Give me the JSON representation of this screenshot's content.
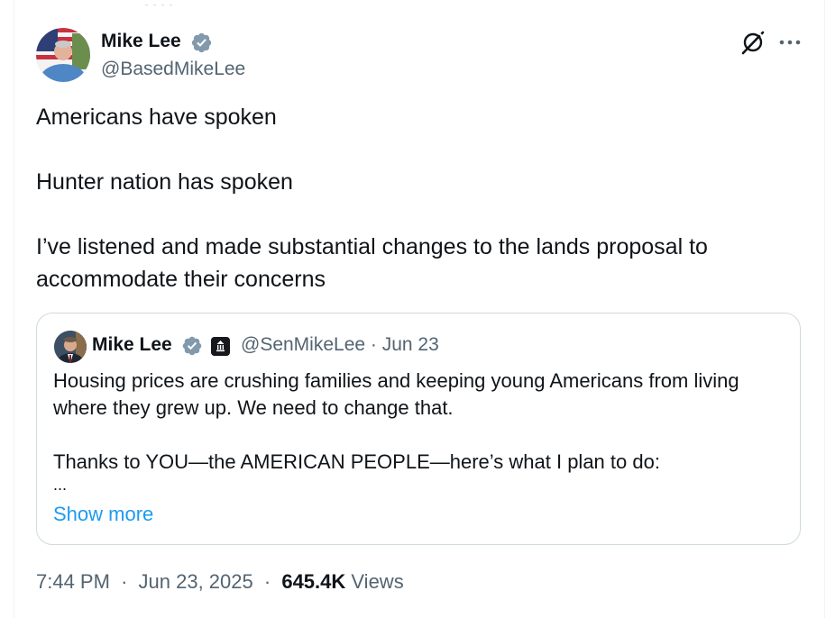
{
  "author": {
    "name": "Mike Lee",
    "handle": "@BasedMikeLee"
  },
  "icons": {
    "verified": "verified-badge-icon",
    "grok": "grok-icon",
    "more": "more-icon",
    "government": "government-badge-icon"
  },
  "colors": {
    "verified": "#829aab",
    "link": "#1d9bf0",
    "secondary_text": "#536471",
    "primary_text": "#0f1419",
    "border": "#cfd9de"
  },
  "tweet": {
    "lines": [
      "Americans have spoken",
      "Hunter nation has spoken",
      "I’ve listened and made substantial changes to the lands proposal to accommodate their concerns"
    ]
  },
  "quote": {
    "name": "Mike Lee",
    "handle_date": "@SenMikeLee · Jun 23",
    "paragraph1": "Housing prices are crushing families and keeping young Americans from living where they grew up. We need to change that.",
    "paragraph2": "Thanks to YOU—the AMERICAN PEOPLE—here’s what I plan to do:",
    "ellipsis": "...",
    "show_more": "Show more"
  },
  "meta": {
    "time": "7:44 PM",
    "date": "Jun 23, 2025",
    "separator": "·",
    "views_count": "645.4K",
    "views_label": "Views"
  }
}
